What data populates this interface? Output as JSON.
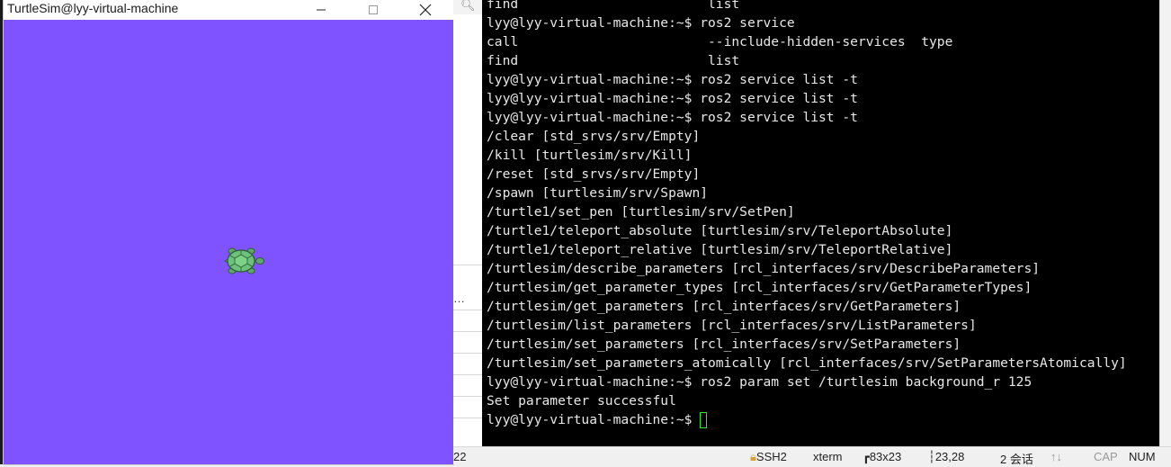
{
  "turtlesim": {
    "title": "TurtleSim@lyy-virtual-machine",
    "background_color": "#7f53ff"
  },
  "middle": {
    "status_number": "22",
    "truncated_text": "…"
  },
  "terminal": {
    "lines": [
      "find                        list",
      "lyy@lyy-virtual-machine:~$ ros2 service",
      "call                        --include-hidden-services  type",
      "find                        list",
      "lyy@lyy-virtual-machine:~$ ros2 service list -t",
      "lyy@lyy-virtual-machine:~$ ros2 service list -t",
      "lyy@lyy-virtual-machine:~$ ros2 service list -t",
      "/clear [std_srvs/srv/Empty]",
      "/kill [turtlesim/srv/Kill]",
      "/reset [std_srvs/srv/Empty]",
      "/spawn [turtlesim/srv/Spawn]",
      "/turtle1/set_pen [turtlesim/srv/SetPen]",
      "/turtle1/teleport_absolute [turtlesim/srv/TeleportAbsolute]",
      "/turtle1/teleport_relative [turtlesim/srv/TeleportRelative]",
      "/turtlesim/describe_parameters [rcl_interfaces/srv/DescribeParameters]",
      "/turtlesim/get_parameter_types [rcl_interfaces/srv/GetParameterTypes]",
      "/turtlesim/get_parameters [rcl_interfaces/srv/GetParameters]",
      "/turtlesim/list_parameters [rcl_interfaces/srv/ListParameters]",
      "/turtlesim/set_parameters [rcl_interfaces/srv/SetParameters]",
      "/turtlesim/set_parameters_atomically [rcl_interfaces/srv/SetParametersAtomically]",
      "lyy@lyy-virtual-machine:~$ ros2 param set /turtlesim background_r 125",
      "Set parameter successful",
      "lyy@lyy-virtual-machine:~$ "
    ],
    "cursor_color": "#32e632"
  },
  "statusbar": {
    "protocol": "SSH2",
    "term_type": "xterm",
    "size": "83x23",
    "cursor_pos": "23,28",
    "sessions": "2 会话",
    "cap": "CAP",
    "num": "NUM"
  }
}
